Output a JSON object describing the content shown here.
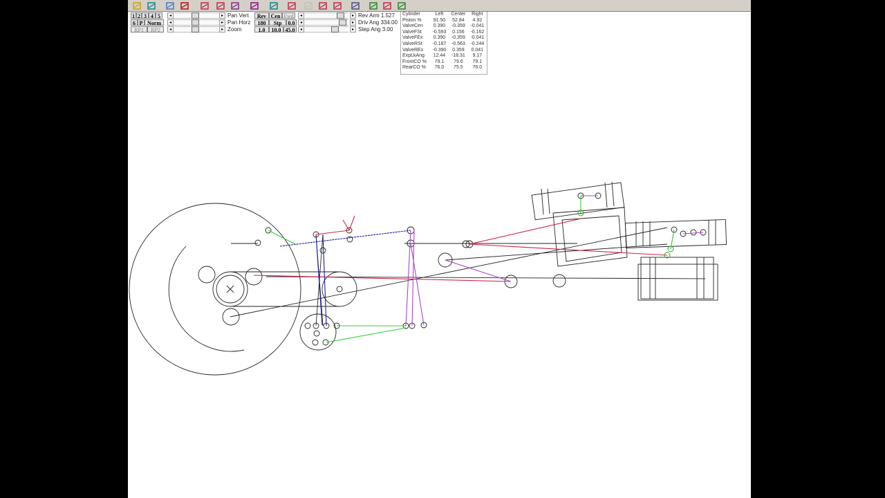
{
  "toolbar": {
    "icons": [
      {
        "name": "open-folder-icon",
        "color": "#c8a000"
      },
      {
        "name": "save-icon",
        "color": "#008080"
      },
      {
        "name": "rotate-icon",
        "color": "#4070c0"
      },
      {
        "name": "print-icon",
        "color": "#b00000"
      },
      {
        "name": "cycle-icon",
        "color": "#c02040"
      },
      {
        "name": "reset-icon",
        "color": "#c02040"
      },
      {
        "name": "pan-icon",
        "color": "#802080"
      },
      {
        "name": "mechanism-icon",
        "color": "#800080"
      },
      {
        "name": "marker-icon",
        "color": "#008080"
      },
      {
        "name": "frame-icon",
        "color": "#c02040"
      },
      {
        "name": "link-icon",
        "color": "#c0c0c0"
      },
      {
        "name": "arm-icon",
        "color": "#c02040"
      },
      {
        "name": "joint-icon",
        "color": "#c02040"
      },
      {
        "name": "wave-icon",
        "color": "#404080"
      },
      {
        "name": "curve-icon",
        "color": "#208020"
      },
      {
        "name": "graph-icon",
        "color": "#c02040"
      },
      {
        "name": "plot-icon",
        "color": "#208020"
      }
    ]
  },
  "controls": {
    "cyl_keys": [
      "1",
      "2",
      "3",
      "4",
      "5"
    ],
    "row2_keys": [
      "6",
      "P",
      "Norm"
    ],
    "row3_keys": [
      "RP1",
      "RP2"
    ],
    "pan_vert": "Pan Vert",
    "pan_horz": "Pan Horz",
    "zoom": "Zoom",
    "mode_keys": [
      "Rev",
      "Cen",
      "Fwd"
    ],
    "row2_mode": [
      "180",
      "Stp",
      "0.0"
    ],
    "row3_mode": [
      "1.0",
      "10.0",
      "45.0"
    ],
    "rev_arm_label": "Rev Arm",
    "rev_arm_value": "1.527",
    "driv_ang_label": "Driv Ang",
    "driv_ang_value": "334.00",
    "step_ang_label": "Step Ang",
    "step_ang_value": "3.00"
  },
  "table": {
    "headers": [
      "Cylinder",
      "Left",
      "Center",
      "Right"
    ],
    "rows": [
      [
        "Piston %",
        "91.50",
        "52.84",
        "4.92"
      ],
      [
        "ValveCen",
        "0.390",
        "-0.359",
        "-0.041"
      ],
      [
        "ValveFSt",
        "-0.593",
        "0.156",
        "-0.162"
      ],
      [
        "ValveFEx",
        "0.390",
        "-0.359",
        "-0.041"
      ],
      [
        "ValveRSt",
        "-0.187",
        "-0.563",
        "-0.244"
      ],
      [
        "ValveREx",
        "-0.390",
        "0.359",
        "0.041"
      ],
      [
        "ExpLkAng",
        "12.44",
        "-18.31",
        "9.17"
      ],
      [
        "FrontCO %",
        "79.1",
        "79.6",
        "79.1"
      ],
      [
        "RearCO %",
        "76.0",
        "75.5",
        "76.0"
      ]
    ]
  },
  "colors": {
    "link_red": "#cc2244",
    "link_blue": "#1a1aa0",
    "link_green": "#33cc33",
    "link_purple": "#aa44cc",
    "line_black": "#222222"
  }
}
